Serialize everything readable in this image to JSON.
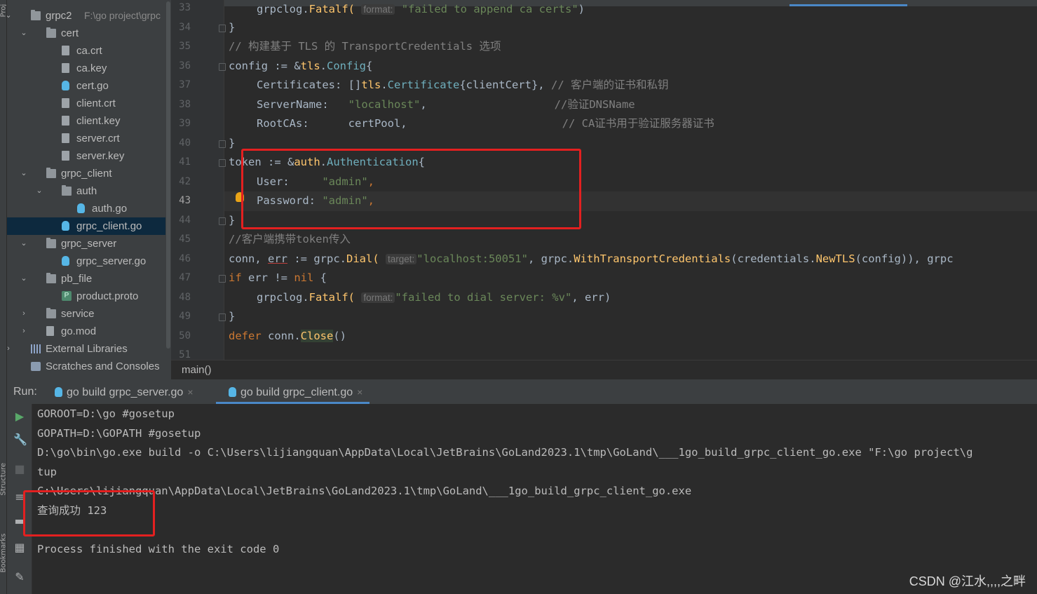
{
  "left_strip": {
    "top_label": "Proj",
    "mid_label": "Structure",
    "bottom_label": "Bookmarks"
  },
  "tree": [
    {
      "label": "grpc2",
      "sub": "F:\\go project\\grpc",
      "icon": "folder-icon",
      "arrow": "⌄"
    },
    {
      "label": "cert",
      "icon": "folder-icon",
      "arrow": "⌄"
    },
    {
      "label": "ca.crt",
      "icon": "file-icon"
    },
    {
      "label": "ca.key",
      "icon": "file-icon"
    },
    {
      "label": "cert.go",
      "icon": "go-file-icon"
    },
    {
      "label": "client.crt",
      "icon": "file-icon"
    },
    {
      "label": "client.key",
      "icon": "file-icon"
    },
    {
      "label": "server.crt",
      "icon": "file-icon"
    },
    {
      "label": "server.key",
      "icon": "file-icon"
    },
    {
      "label": "grpc_client",
      "icon": "folder-icon",
      "arrow": "⌄"
    },
    {
      "label": "auth",
      "icon": "folder-icon",
      "arrow": "⌄"
    },
    {
      "label": "auth.go",
      "icon": "go-file-icon"
    },
    {
      "label": "grpc_client.go",
      "icon": "go-file-icon",
      "selected": true
    },
    {
      "label": "grpc_server",
      "icon": "folder-icon",
      "arrow": "⌄"
    },
    {
      "label": "grpc_server.go",
      "icon": "go-file-icon"
    },
    {
      "label": "pb_file",
      "icon": "folder-icon",
      "arrow": "⌄"
    },
    {
      "label": "product.proto",
      "icon": "proto-file-icon"
    },
    {
      "label": "service",
      "icon": "folder-icon",
      "arrow": "›"
    },
    {
      "label": "go.mod",
      "icon": "file-icon",
      "arrow": "›"
    },
    {
      "label": "External Libraries",
      "icon": "library-icon",
      "arrow": "›"
    },
    {
      "label": "Scratches and Consoles",
      "icon": "scratch-icon"
    }
  ],
  "editor": {
    "line_numbers": [
      "33",
      "34",
      "35",
      "36",
      "37",
      "38",
      "39",
      "40",
      "41",
      "42",
      "43",
      "44",
      "45",
      "46",
      "47",
      "48",
      "49",
      "50",
      "51"
    ],
    "current_line": "43",
    "code": {
      "l33_a": "grpclog.",
      "l33_fn": "Fatalf(",
      "l33_hint": "format:",
      "l33_str": "\"failed to append ca certs\"",
      "l33_end": ")",
      "l34": "}",
      "l35": "// 构建基于 TLS 的 TransportCredentials 选项",
      "l36_a": "config := &",
      "l36_pkg": "tls",
      "l36_dot": ".",
      "l36_typ": "Config",
      "l36_end": "{",
      "l37_a": "Certificates: []",
      "l37_pkg": "tls",
      "l37_dot": ".",
      "l37_typ": "Certificate",
      "l37_b": "{clientCert},",
      "l37_cm": "// 客户端的证书和私钥",
      "l38_a": "ServerName:   ",
      "l38_str": "\"localhost\"",
      "l38_b": ",",
      "l38_cm": "//验证DNSName",
      "l39_a": "RootCAs:      certPool,",
      "l39_cm": "// CA证书用于验证服务器证书",
      "l40": "}",
      "l41_a": "token := &",
      "l41_pkg": "auth",
      "l41_dot": ".",
      "l41_typ": "Authentication",
      "l41_end": "{",
      "l42_a": "User:     ",
      "l42_str": "\"admin\"",
      "l42_b": ",",
      "l43_a": "Password: ",
      "l43_str": "\"admin\"",
      "l43_b": ",",
      "l44": "}",
      "l45": "//客户端携带token传入",
      "l46_a": "conn, ",
      "l46_err": "err",
      "l46_b": " := grpc.",
      "l46_fn": "Dial(",
      "l46_hint": "target:",
      "l46_str": "\"localhost:50051\"",
      "l46_c": ", grpc.",
      "l46_fn2": "WithTransportCredentials",
      "l46_d": "(credentials.",
      "l46_fn3": "NewTLS",
      "l46_e": "(config)), grpc",
      "l47_kw": "if",
      "l47_a": " err != ",
      "l47_kw2": "nil",
      "l47_b": " {",
      "l48_a": "grpclog.",
      "l48_fn": "Fatalf(",
      "l48_hint": "format:",
      "l48_str": "\"failed to dial server: %v\"",
      "l48_b": ", err)",
      "l49": "}",
      "l50_kw": "defer",
      "l50_a": " conn.",
      "l50_fn": "Close",
      "l50_b": "()"
    },
    "breadcrumb": "main()"
  },
  "run": {
    "label": "Run:",
    "tabs": [
      {
        "label": "go build grpc_server.go",
        "active": false
      },
      {
        "label": "go build grpc_client.go",
        "active": true
      }
    ],
    "close_glyph": "×",
    "tools": [
      "play-icon",
      "wrench-icon",
      "stop-icon",
      "soft-wrap-icon",
      "trash-icon",
      "layout-icon",
      "pin-icon"
    ],
    "console": [
      "GOROOT=D:\\go #gosetup",
      "GOPATH=D:\\GOPATH #gosetup",
      "D:\\go\\bin\\go.exe build -o C:\\Users\\lijiangquan\\AppData\\Local\\JetBrains\\GoLand2023.1\\tmp\\GoLand\\___1go_build_grpc_client_go.exe \"F:\\go project\\g",
      "tup",
      "C:\\Users\\lijiangquan\\AppData\\Local\\JetBrains\\GoLand2023.1\\tmp\\GoLand\\___1go_build_grpc_client_go.exe",
      "查询成功 123",
      "",
      "Process finished with the exit code 0"
    ]
  },
  "watermark": "CSDN @江水,,,,之畔",
  "colors": {
    "highlight_box": "#e32020",
    "accent": "#4a88c7",
    "keyword": "#cc7832",
    "string": "#6a8759"
  }
}
